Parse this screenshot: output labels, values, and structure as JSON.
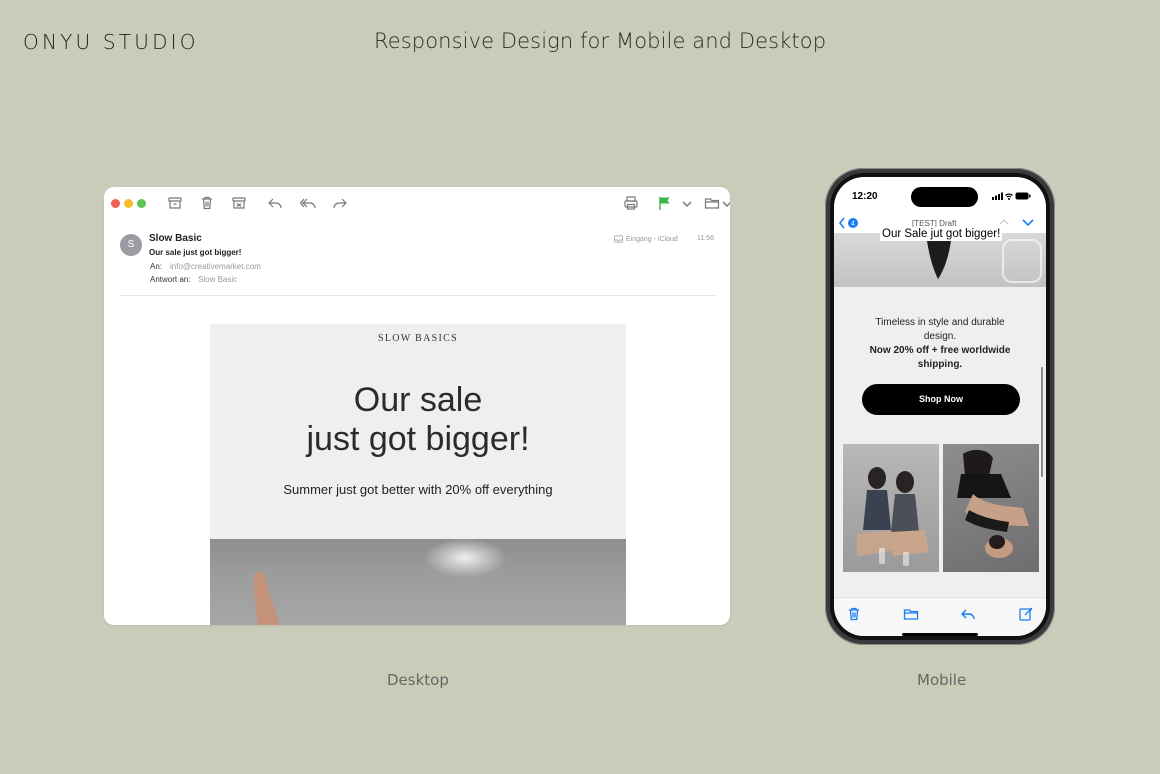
{
  "brand": "ONYU STUDIO",
  "headline": "Responsive Design for Mobile and Desktop",
  "captions": {
    "desktop": "Desktop",
    "mobile": "Mobile"
  },
  "desktop": {
    "sender_initial": "S",
    "sender_name": "Slow Basic",
    "subject": "Our sale just got bigger!",
    "to_label": "An:",
    "to_value": "info@creativemarket.com",
    "reply_label": "Antwort an:",
    "reply_value": "Slow Basic",
    "mailbox": "Eingang - iCloud",
    "time": "11:56",
    "email": {
      "brand": "SLOW BASICS",
      "hero_line1": "Our sale",
      "hero_line2": "just got bigger!",
      "subline": "Summer just got better with 20% off everything"
    }
  },
  "mobile": {
    "status_time": "12:20",
    "back_badge": "4",
    "nav_title": "[TEST] Draft",
    "subject": "Our Sale jut got bigger!",
    "body_line1": "Timeless in style and durable",
    "body_line2": "design.",
    "offer_line1": "Now 20% off + free worldwide",
    "offer_line2": "shipping.",
    "button": "Shop Now"
  },
  "colors": {
    "background": "#cbcbb9",
    "accent_blue": "#1a7cf5",
    "flag_green": "#3bb449",
    "button_black": "#000000"
  },
  "icons": [
    "archive-icon",
    "trash-icon",
    "junk-icon",
    "reply-icon",
    "reply-all-icon",
    "forward-icon",
    "print-icon",
    "flag-icon",
    "chevron-down-icon",
    "folder-icon",
    "back-chevron-icon",
    "chevron-up-icon",
    "compose-icon"
  ]
}
